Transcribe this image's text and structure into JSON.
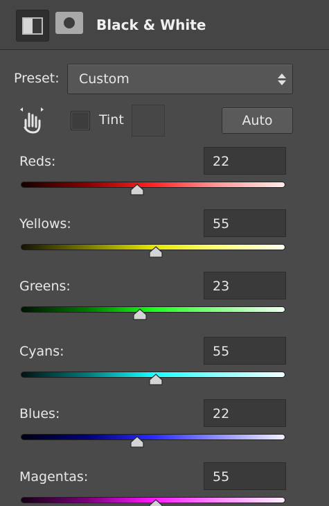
{
  "panel": {
    "title": "Black & White",
    "header_icons": [
      "black-white-adjustment-icon",
      "layer-mask-icon"
    ]
  },
  "preset": {
    "label": "Preset:",
    "value": "Custom"
  },
  "tools": {
    "targeted_adjustment_icon": "hand-scrubby-icon",
    "tint_label": "Tint",
    "tint_checked": false,
    "auto_label": "Auto"
  },
  "sliders": [
    {
      "label": "Reds:",
      "value": "22",
      "position": 0.44,
      "colors": [
        "#140000",
        "#8a0000",
        "#ff2424",
        "#ff9a9a",
        "#ffecec"
      ]
    },
    {
      "label": "Yellows:",
      "value": "55",
      "position": 0.51,
      "colors": [
        "#141400",
        "#7a7a00",
        "#e6e600",
        "#ffff78",
        "#fffff0"
      ]
    },
    {
      "label": "Greens:",
      "value": "23",
      "position": 0.45,
      "colors": [
        "#001400",
        "#007a00",
        "#1aff1a",
        "#8cff8c",
        "#f0fff0"
      ]
    },
    {
      "label": "Cyans:",
      "value": "55",
      "position": 0.51,
      "colors": [
        "#001414",
        "#007a7a",
        "#19ffff",
        "#8cffff",
        "#f0ffff"
      ]
    },
    {
      "label": "Blues:",
      "value": "22",
      "position": 0.44,
      "colors": [
        "#000014",
        "#00007a",
        "#2a2aff",
        "#9090ff",
        "#f0f0ff"
      ]
    },
    {
      "label": "Magentas:",
      "value": "55",
      "position": 0.51,
      "colors": [
        "#140014",
        "#7a007a",
        "#ff1aff",
        "#ff8cff",
        "#fff0ff"
      ]
    }
  ]
}
